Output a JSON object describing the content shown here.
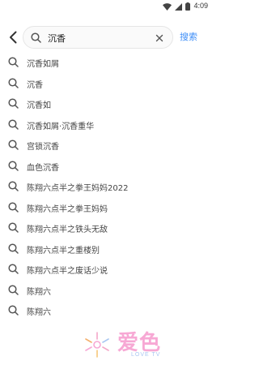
{
  "status_bar": {
    "time": "4:09",
    "icons": [
      "wifi-icon",
      "signal-icon",
      "battery-icon"
    ]
  },
  "search": {
    "query": "沉香",
    "submit_label": "搜索",
    "icons": [
      "back-arrow-icon",
      "search-icon",
      "clear-icon"
    ]
  },
  "suggestions": [
    {
      "label": "沉香如屑"
    },
    {
      "label": "沉香"
    },
    {
      "label": "沉香如"
    },
    {
      "label": "沉香如屑·沉香重华"
    },
    {
      "label": "宫锁沉香"
    },
    {
      "label": "血色沉香"
    },
    {
      "label": "陈翔六点半之拳王妈妈2022"
    },
    {
      "label": "陈翔六点半之拳王妈妈"
    },
    {
      "label": "陈翔六点半之铁头无敌"
    },
    {
      "label": "陈翔六点半之重楼别"
    },
    {
      "label": "陈翔六点半之废话少说"
    },
    {
      "label": "陈翔六"
    },
    {
      "label": "陈翔六"
    }
  ],
  "watermark": {
    "text": "爱色",
    "subtext": "LOVE TV"
  },
  "colors": {
    "accent": "#3e8ef7",
    "watermark_pink": "#f7a8d4",
    "watermark_blue": "#a9c7f2"
  }
}
